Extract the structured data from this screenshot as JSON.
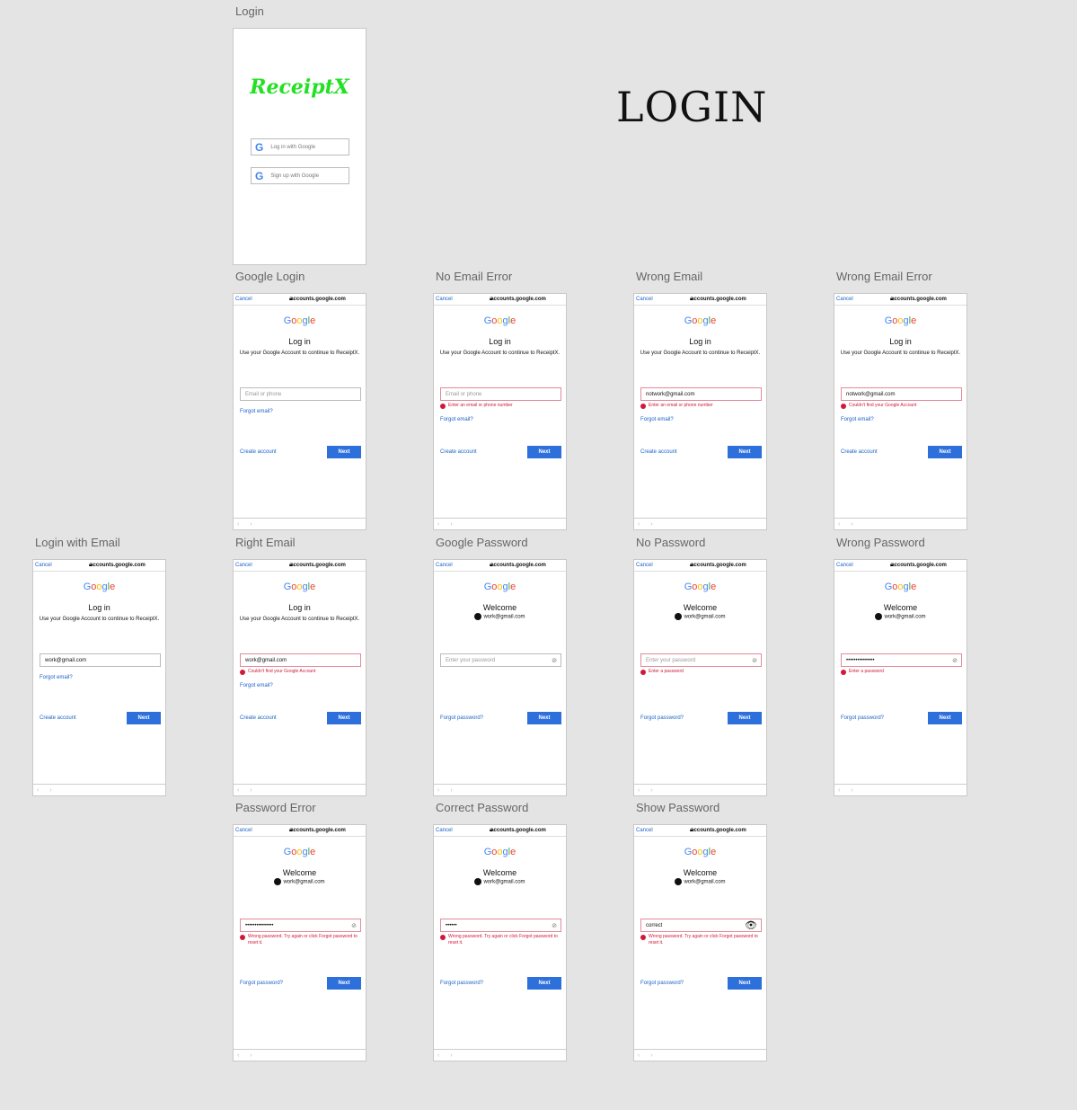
{
  "page_title": "LOGIN",
  "login_artboard": {
    "label": "Login",
    "logo": "ReceiptX",
    "buttons": [
      "Log in with Google",
      "Sign up with Google"
    ]
  },
  "common": {
    "cancel": "Cancel",
    "url": "accounts.google.com",
    "google": "Google",
    "next": "Next",
    "login_title": "Log in",
    "login_sub": "Use your Google Account to continue to ReceiptX.",
    "welcome": "Welcome",
    "account": "work@gmail.com",
    "forgot_email": "Forgot email?",
    "create_account": "Create account",
    "forgot_password": "Forgot password?"
  },
  "google_colors": [
    "#4285f4",
    "#ea4335",
    "#fbbc05",
    "#4285f4",
    "#34a853",
    "#ea4335"
  ],
  "artboards": [
    {
      "label": "Google Login",
      "kind": "email",
      "placeholder": "Email or phone",
      "value": "",
      "error": "",
      "red": false
    },
    {
      "label": "No Email Error",
      "kind": "email",
      "placeholder": "Email or phone",
      "value": "",
      "error": "Enter an email or phone number",
      "red": true
    },
    {
      "label": "Wrong Email",
      "kind": "email",
      "value": "notwork@gmail.com",
      "error": "Enter an email or phone number",
      "red": true
    },
    {
      "label": "Wrong Email Error",
      "kind": "email",
      "value": "notwork@gmail.com",
      "error": "Couldn't find your Google Account",
      "red": true
    },
    {
      "label": "Login with Email",
      "kind": "email",
      "value": "work@gmail.com",
      "error": "",
      "red": false
    },
    {
      "label": "Right Email",
      "kind": "email",
      "value": "work@gmail.com",
      "error": "Couldn't find your Google Account",
      "red": true
    },
    {
      "label": "Google Password",
      "kind": "password",
      "placeholder": "Enter your password",
      "value": "",
      "error": "",
      "red": false,
      "eye": "hidden"
    },
    {
      "label": "No Password",
      "kind": "password",
      "placeholder": "Enter your password",
      "value": "",
      "error": "Enter a password",
      "red": true,
      "eye": "hidden"
    },
    {
      "label": "Wrong Password",
      "kind": "password",
      "value": "•••••••••••••••",
      "error": "Enter a password",
      "red": true,
      "eye": "hidden"
    },
    {
      "label": "Password Error",
      "kind": "password",
      "value": "•••••••••••••••",
      "error": "Wrong password. Try again or click Forgot password to reset it.",
      "red": true,
      "eye": "hidden"
    },
    {
      "label": "Correct Password",
      "kind": "password",
      "value": "••••••",
      "error": "Wrong password. Try again or click Forgot password to reset it.",
      "red": true,
      "eye": "hidden"
    },
    {
      "label": "Show Password",
      "kind": "password",
      "value": "correct",
      "error": "Wrong password. Try again or click Forgot password to reset it.",
      "red": true,
      "eye": "open"
    }
  ]
}
